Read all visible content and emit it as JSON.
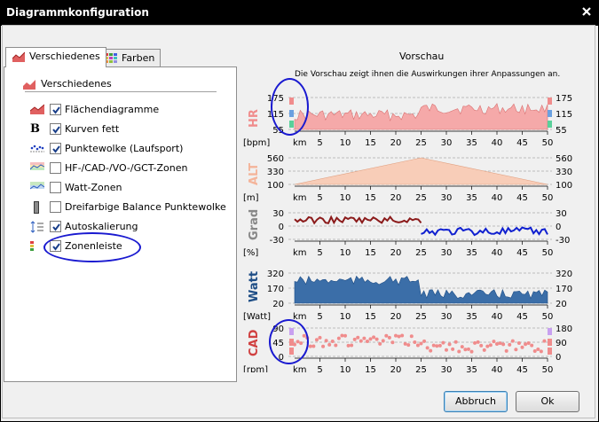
{
  "window": {
    "title": "Diagrammkonfiguration",
    "close_icon": "close-icon"
  },
  "tabs": [
    {
      "label": "Verschiedenes",
      "icon": "area-chart-icon",
      "active": true
    },
    {
      "label": "Farben",
      "icon": "color-palette-icon",
      "active": false
    }
  ],
  "group": {
    "title": "Verschiedenes",
    "icon": "area-chart-icon"
  },
  "options": [
    {
      "label": "Flächendiagramme",
      "icon": "area-chart-icon",
      "checked": true
    },
    {
      "label": "Kurven fett",
      "icon": "bold-b-icon",
      "checked": true
    },
    {
      "label": "Punktewolke (Laufsport)",
      "icon": "scatter-icon",
      "checked": true
    },
    {
      "label": "HF-/CAD-/VO-/GCT-Zonen",
      "icon": "zones-chart-icon",
      "checked": false
    },
    {
      "label": "Watt-Zonen",
      "icon": "watt-zones-icon",
      "checked": false
    },
    {
      "label": "Dreifarbige Balance Punktewolke",
      "icon": "balance-bar-icon",
      "checked": false
    },
    {
      "label": "Autoskalierung",
      "icon": "autoscale-icon",
      "checked": true
    },
    {
      "label": "Zonenleiste",
      "icon": "zone-bar-icon",
      "checked": true
    }
  ],
  "preview": {
    "title": "Vorschau",
    "subtitle": "Die Vorschau zeigt ihnen die Auswirkungen ihrer Anpassungen an.",
    "x_unit": "km",
    "x_ticks": [
      "5",
      "10",
      "15",
      "20",
      "25",
      "30",
      "35",
      "40",
      "45",
      "50"
    ]
  },
  "chart_data": [
    {
      "type": "area",
      "name": "HR",
      "unit": "[bpm]",
      "color": "#f08c8c",
      "yticks_left": [
        "175",
        "115",
        "55"
      ],
      "yticks_right": [
        "175",
        "115",
        "55"
      ],
      "x": [
        0,
        25,
        50
      ],
      "note": ""
    },
    {
      "type": "area",
      "name": "ALT",
      "unit": "[m]",
      "color": "#f4b49a",
      "yticks_left": [
        "560",
        "330",
        "100"
      ],
      "yticks_right": [
        "560",
        "330",
        "100"
      ],
      "x": [
        0,
        25,
        50
      ],
      "values": [
        100,
        560,
        100
      ]
    },
    {
      "type": "line",
      "name": "Grad",
      "unit": "[%]",
      "yticks_left": [
        "30",
        "0",
        "-30"
      ],
      "yticks_right": [
        "30",
        "0",
        "-30"
      ]
    },
    {
      "type": "area",
      "name": "Watt",
      "unit": "[Watt]",
      "color": "#1f4e86",
      "yticks_left": [
        "320",
        "170",
        "20"
      ],
      "yticks_right": [
        "320",
        "170",
        "20"
      ]
    },
    {
      "type": "scatter",
      "name": "CAD",
      "unit": "[rpm]",
      "color": "#f08c8c",
      "yticks_left": [
        "90",
        "45",
        "0"
      ],
      "yticks_right": [
        "180",
        "90",
        "0"
      ]
    }
  ],
  "buttons": {
    "cancel": "Abbruch",
    "ok": "Ok"
  },
  "colors": {
    "titlebar": "#000000",
    "hr": "#f08c8c",
    "alt": "#f4b49a",
    "grad_pos": "#8b1a1a",
    "grad_neg": "#1020d0",
    "watt": "#1f4e86",
    "annotation": "#1a1ad0"
  }
}
